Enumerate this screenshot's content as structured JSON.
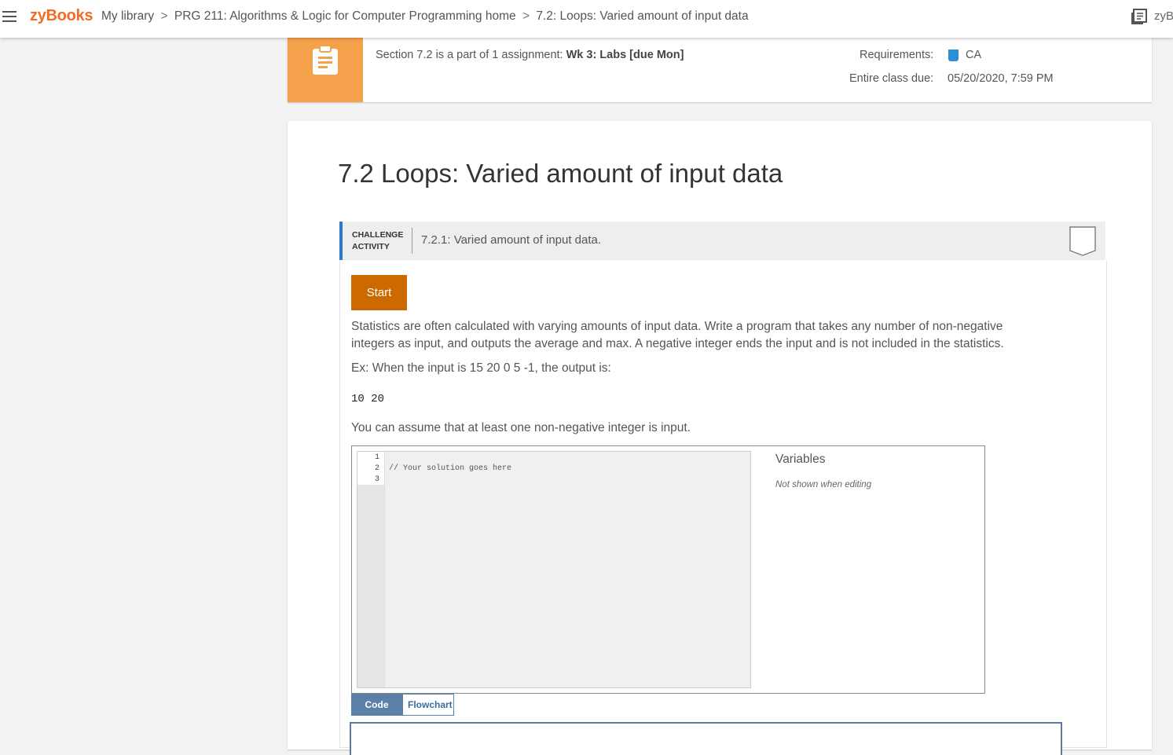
{
  "header": {
    "logo": "zyBooks",
    "breadcrumb": {
      "library": "My library",
      "course": "PRG 211: Algorithms & Logic for Computer Programming home",
      "section": "7.2: Loops: Varied amount of input data",
      "separator": ">"
    },
    "right_text": "zyB"
  },
  "assignment": {
    "text_prefix": "Section 7.2 is a part of 1 assignment:",
    "assignment_name": "Wk 3: Labs [due Mon]",
    "requirements_label": "Requirements:",
    "requirements_value": "CA",
    "due_label": "Entire class due:",
    "due_value": "05/20/2020, 7:59 PM",
    "icon_color": "#f5a04a"
  },
  "section": {
    "title": "7.2 Loops: Varied amount of input data"
  },
  "activity": {
    "type_line1": "CHALLENGE",
    "type_line2": "ACTIVITY",
    "title": "7.2.1: Varied amount of input data.",
    "start_label": "Start",
    "prompt": "Statistics are often calculated with varying amounts of input data. Write a program that takes any number of non-negative integers as input, and outputs the average and max. A negative integer ends the input and is not included in the statistics.",
    "example": "Ex: When the input is 15 20 0 5 -1, the output is:",
    "example_output": "10 20",
    "assumption": "You can assume that at least one non-negative integer is input.",
    "accent_color": "#2a7ac8",
    "start_color": "#cc6a00"
  },
  "editor": {
    "lines": [
      {
        "num": "1",
        "code": ""
      },
      {
        "num": "2",
        "code": "// Your solution goes here"
      },
      {
        "num": "3",
        "code": ""
      }
    ],
    "variables_title": "Variables",
    "variables_note": "Not shown when editing"
  },
  "tabs": {
    "code": "Code",
    "flowchart": "Flowchart"
  }
}
